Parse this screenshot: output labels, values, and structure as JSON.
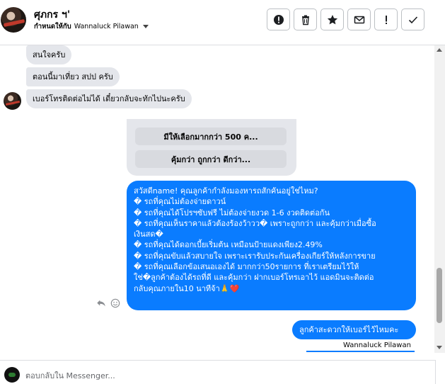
{
  "header": {
    "contact_name": "ศุภกร ฯ'",
    "assigned_label": "กำหนดให้กับ",
    "assigned_to": "Wannaluck Pilawan",
    "tools": [
      {
        "name": "flag-button",
        "icon": "exclamation-circle-icon"
      },
      {
        "name": "delete-button",
        "icon": "trash-icon"
      },
      {
        "name": "star-button",
        "icon": "star-icon"
      },
      {
        "name": "mark-unread-button",
        "icon": "envelope-icon"
      },
      {
        "name": "spam-button",
        "icon": "exclamation-icon"
      },
      {
        "name": "done-button",
        "icon": "checkmark-icon"
      }
    ]
  },
  "messages": {
    "incoming": [
      "สนใจครับ",
      "ตอนนี้มาเที่ยว สปป ครับ",
      "เบอร์โทรติดต่อไม่ได้ เดี๋ยวกลับจะทักไปนะครับ"
    ],
    "quick_replies": [
      "มีให้เลือกมากกว่า 500 ค...",
      "คุ้มกว่า ถูกกว่า ดีกว่า..."
    ],
    "outgoing_long": [
      "สวัสดีname! คุณลูกค้ากำลังมองหารถสักคันอยู่ใช่ไหม?",
      "� รถที่คุณไม่ต้องจ่ายดาวน์",
      "� รถที่คุณได้โปรฯซับฟรี ไม่ต้องจ่ายงวด 1-6 งวดติดต่อกัน",
      "� รถที่คุณเห็นราคาแล้วต้องร้องว้าวว� เพราะถูกกว่า และคุ้มกว่าเมื่อซื้อ",
      "เงินสด�",
      "� รถที่คุณได้ดอกเบี้ยเริ่มต้น เหมือนป้ายแดงเพียง2.49%",
      "� รถที่คุณขับแล้วสบายใจ เพราะเรารับประกันเครื่องเกียร์ให้หลังการขาย",
      "� รถที่คุณเลือกข้อเสนอเองได้ มากกว่า50รายการ ที่เราเตรียมไว้ให้",
      "ใช่�ลูกค้าต้องได้รถที่ดี และคุ้มกว่า ฝากเบอร์โทรเอาไว้ แอดมินจะติดต่อ",
      "กลับคุณภายใน10 นาทีจ้า🙏❤️"
    ],
    "outgoing_short": "ลูกค้าสะดวกให้เบอร์ไว้ไหมคะ",
    "sender_name": "Wannaluck Pilawan"
  },
  "composer": {
    "placeholder": "ตอบกลับใน Messenger..."
  },
  "colors": {
    "outgoing_bubble": "#0a7cff",
    "incoming_bubble": "#e4e6eb",
    "border": "#bcc0c4"
  }
}
